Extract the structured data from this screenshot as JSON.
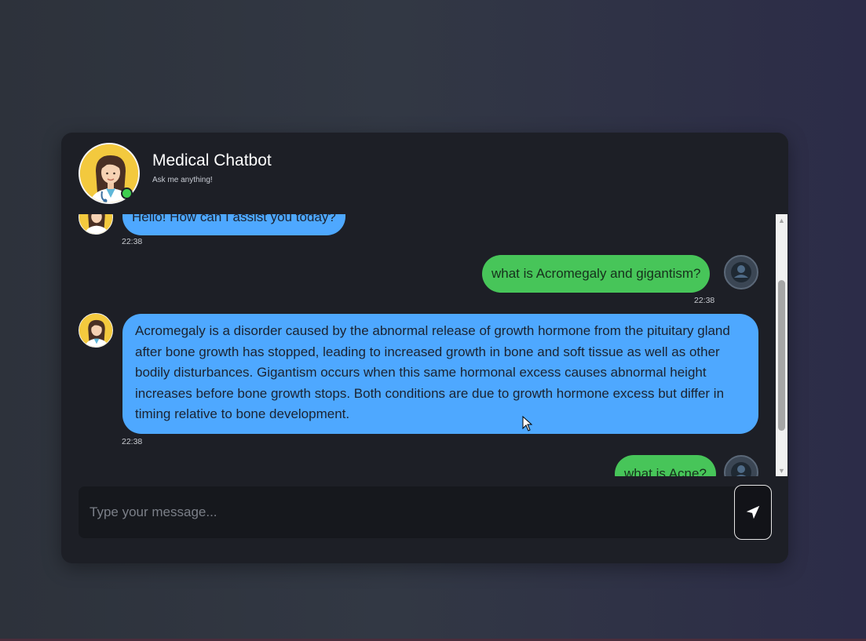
{
  "header": {
    "title": "Medical Chatbot",
    "subtitle": "Ask me anything!",
    "status": "online"
  },
  "messages": [
    {
      "sender": "bot",
      "text": "Hello! How can I assist you today?",
      "time": "22:38"
    },
    {
      "sender": "user",
      "text": "what is Acromegaly and gigantism?",
      "time": "22:38"
    },
    {
      "sender": "bot",
      "text": "Acromegaly is a disorder caused by the abnormal release of growth hormone from the pituitary gland after bone growth has stopped, leading to increased growth in bone and soft tissue as well as other bodily disturbances. Gigantism occurs when this same hormonal excess causes abnormal height increases before bone growth stops. Both conditions are due to growth hormone excess but differ in timing relative to bone development.",
      "time": "22:38"
    },
    {
      "sender": "user",
      "text": "what is Acne?",
      "time": ""
    }
  ],
  "input": {
    "placeholder": "Type your message...",
    "value": ""
  },
  "colors": {
    "bot_bubble": "#4ea8ff",
    "user_bubble": "#47c559",
    "card_bg": "#1d1f26",
    "online": "#3fce4f"
  },
  "icons": {
    "send": "send-arrow-icon",
    "bot_avatar": "doctor-avatar-icon",
    "user_avatar": "user-avatar-icon"
  }
}
